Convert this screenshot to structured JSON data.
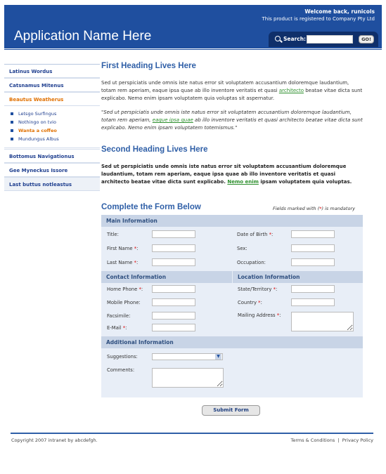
{
  "header": {
    "welcome": "Welcome back, runicols",
    "registered": "This product is registered to Company Pty Ltd",
    "app_name": "Application Name Here",
    "search_label": "Search:",
    "go_label": "GO!"
  },
  "sidebar": {
    "items": [
      {
        "label": "Latinus Wordus"
      },
      {
        "label": "Catsnamus Mitenus"
      },
      {
        "label": "Beautus Weatherus"
      },
      {
        "label": "Bottomus Navigationus"
      },
      {
        "label": "Gee Myneckus Issore"
      },
      {
        "label": "Last buttus notleastus"
      }
    ],
    "subitems": [
      {
        "label": "Letsgo Surfingus"
      },
      {
        "label": "Nothingo on tvio"
      },
      {
        "label": "Wanta a coffeo"
      },
      {
        "label": "Mundungus Albus"
      }
    ]
  },
  "main": {
    "heading1": "First Heading Lives Here",
    "para1_a": "Sed ut perspiciatis unde omnis iste natus error sit voluptatem accusantium doloremque laudantium, totam rem aperiam, eaque ipsa quae ab illo inventore veritatis et quasi ",
    "para1_link": "architecto",
    "para1_b": " beatae vitae dicta sunt explicabo. Nemo enim ipsam voluptatem quia voluptas sit aspernatur.",
    "quote_a": "\"Sed ut perspiciatis unde omnis iste natus error sit voluptatem accusantium doloremque laudantium, totam rem aperiam, ",
    "quote_link": "eaque ipsa quae",
    "quote_b": " ab illo inventore veritatis et quasi architecto beatae vitae dicta sunt explicabo. Nemo enim ipsam voluptatem totemismus.\"",
    "heading2": "Second Heading Lives Here",
    "para2_a": "Sed ut perspiciatis unde omnis iste natus error sit voluptatem accusantium doloremque laudantium, totam rem aperiam, eaque ipsa quae ab illo inventore veritatis et quasi architecto beatae vitae dicta sunt explicabo. ",
    "para2_link": "Nemo enim",
    "para2_b": " ipsam voluptatem quia voluptas."
  },
  "form": {
    "title": "Complete the Form Below",
    "mandatory_a": "Fields marked with (",
    "mandatory_star": "*",
    "mandatory_b": ") is mandatory",
    "req_mark": "*",
    "sections": {
      "main": "Main Information",
      "contact": "Contact Information",
      "location": "Location Information",
      "additional": "Additional Information"
    },
    "labels": {
      "title": "Title:",
      "first_name": "First Name ",
      "last_name": "Last Name ",
      "dob": "Date of Birth ",
      "sex": "Sex:",
      "occupation": "Occupation:",
      "home_phone": "Home Phone ",
      "mobile_phone": "Mobile Phone:",
      "facsimile": "Facsimile:",
      "email": "E-Mail ",
      "state": "State/Territory ",
      "country": "Country ",
      "mailing": "Mailing Address ",
      "suggestions": "Suggestions:",
      "comments": "Comments:"
    },
    "colon": ":",
    "submit": "Submit Form"
  },
  "footer": {
    "copyright": "Copyright 2007 intranet by abcdefgh.",
    "terms": "Terms & Conditions",
    "separator": "|",
    "privacy": "Privacy Policy"
  },
  "colors": {
    "brand": "#1f4f9f",
    "heading": "#2f5fa7",
    "active_nav": "#e07000",
    "link_green": "#2d8f2d"
  }
}
